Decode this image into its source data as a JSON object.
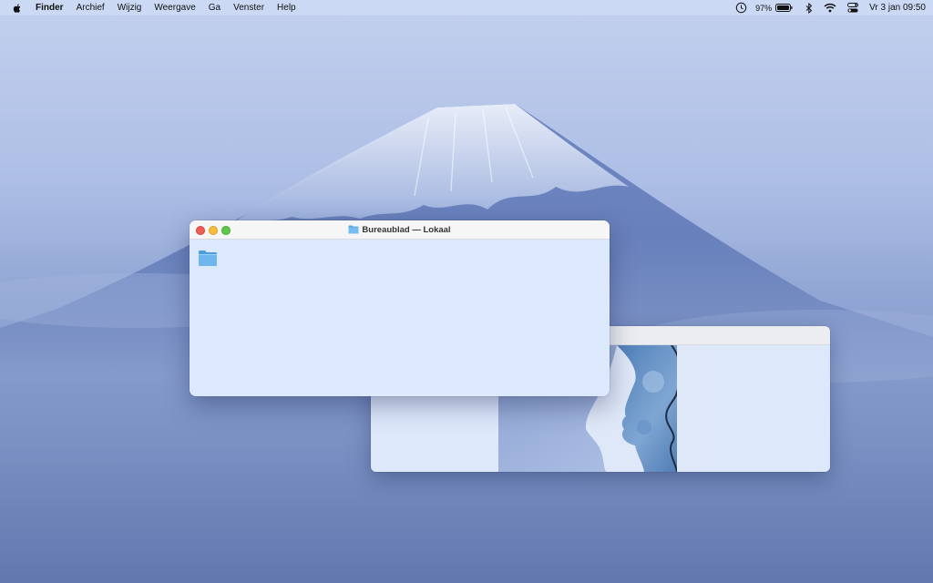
{
  "menubar": {
    "app_name": "Finder",
    "menus": [
      "Archief",
      "Wijzig",
      "Weergave",
      "Ga",
      "Venster",
      "Help"
    ],
    "battery_percent": "97%",
    "datetime": "Vr 3 jan  09:50"
  },
  "finder_window": {
    "title": "Bureaublad — Lokaal"
  },
  "colors": {
    "close": "#ee5e56",
    "minimize": "#f6bd3a",
    "maximize": "#5ec64a",
    "folder": "#6bb3ea"
  }
}
